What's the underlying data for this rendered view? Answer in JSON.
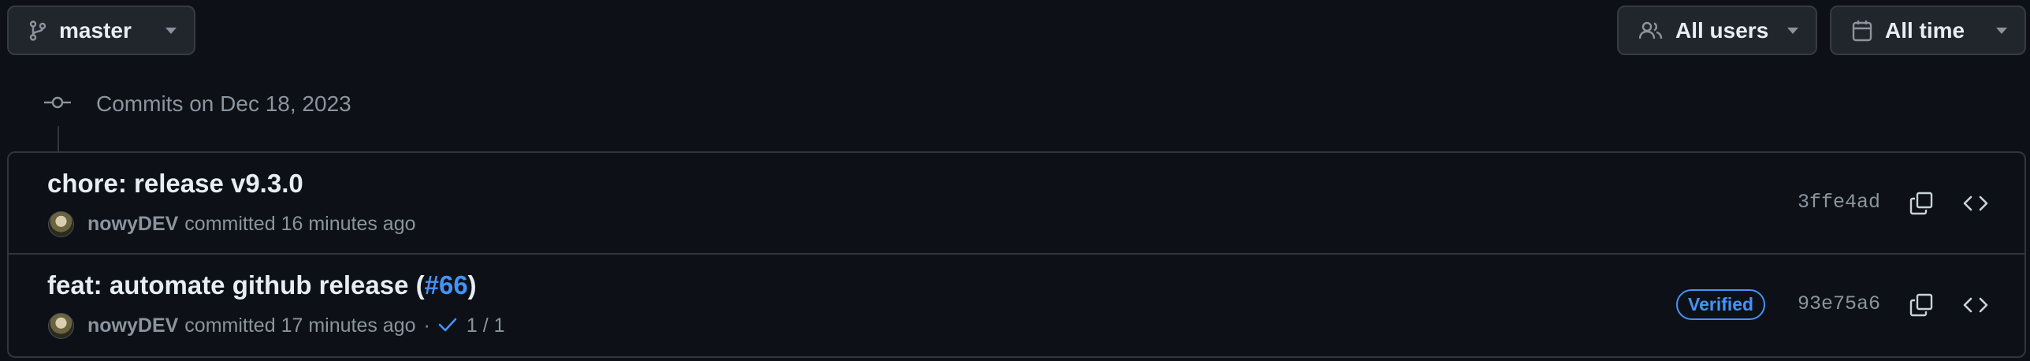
{
  "toolbar": {
    "branch_label": "master",
    "users_label": "All users",
    "time_label": "All time"
  },
  "commit_group": {
    "title": "Commits on Dec 18, 2023"
  },
  "commits": [
    {
      "message": "chore: release v9.3.0",
      "author": "nowyDEV",
      "action": "committed",
      "time": "16 minutes ago",
      "sha": "3ffe4ad"
    },
    {
      "message_prefix": "feat: automate github release (",
      "pr_link": "#66",
      "message_suffix": ")",
      "author": "nowyDEV",
      "action": "committed",
      "time": "17 minutes ago",
      "separator": "·",
      "checks": "1 / 1",
      "badge": "Verified",
      "sha": "93e75a6"
    }
  ],
  "icons": {
    "branch": "git-branch-icon",
    "users": "people-icon",
    "calendar": "calendar-icon",
    "caret": "triangle-down-icon",
    "commit": "git-commit-icon",
    "copy": "copy-icon",
    "browse": "code-icon",
    "check": "check-icon"
  },
  "colors": {
    "background": "#0d1117",
    "button": "#21262d",
    "border": "#30363d",
    "text": "#e6edf3",
    "muted": "#8b949e",
    "link": "#4493f8"
  }
}
